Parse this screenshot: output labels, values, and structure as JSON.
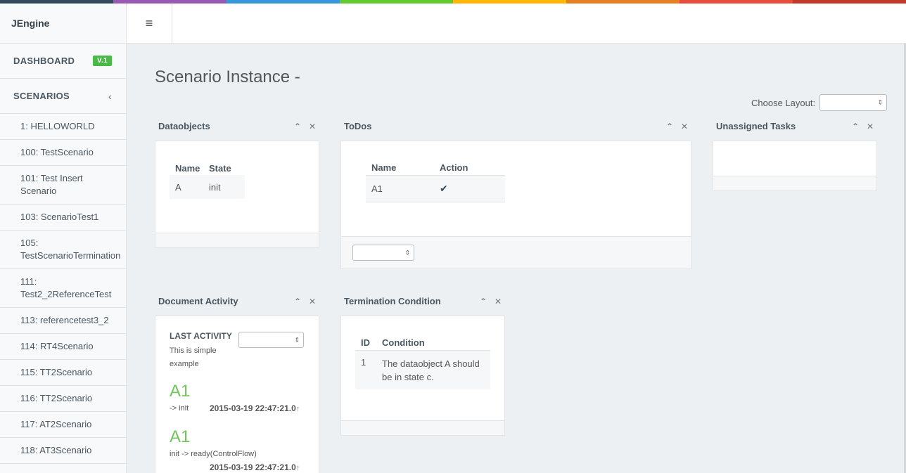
{
  "colors": {
    "topbar": [
      "#34495e",
      "#9b59b6",
      "#3498db",
      "#62cb31",
      "#ffb606",
      "#e67e22",
      "#e74c3c",
      "#c0392b"
    ],
    "accent_green": "#62cb31"
  },
  "sidebar": {
    "brand": "JEngine",
    "dashboard_label": "DASHBOARD",
    "dashboard_badge": "V.1",
    "scenarios_label": "SCENARIOS",
    "scenarios_chevron_icon": "chevron-left-icon",
    "items": [
      {
        "line1": "1: HELLOWORLD",
        "line2": ""
      },
      {
        "line1": "100: TestScenario",
        "line2": ""
      },
      {
        "line1": "101: Test Insert",
        "line2": "Scenario"
      },
      {
        "line1": "103: ScenarioTest1",
        "line2": ""
      },
      {
        "line1": "105:",
        "line2": "TestScenarioTermination"
      },
      {
        "line1": "111:",
        "line2": "Test2_2ReferenceTest"
      },
      {
        "line1": "113: referencetest3_2",
        "line2": ""
      },
      {
        "line1": "114: RT4Scenario",
        "line2": ""
      },
      {
        "line1": "115: TT2Scenario",
        "line2": ""
      },
      {
        "line1": "116: TT2Scenario",
        "line2": ""
      },
      {
        "line1": "117: AT2Scenario",
        "line2": ""
      },
      {
        "line1": "118: AT3Scenario",
        "line2": ""
      }
    ]
  },
  "header": {
    "menu_icon": "hamburger-icon"
  },
  "main": {
    "title": "Scenario Instance -",
    "choose_layout_label": "Choose Layout:",
    "choose_layout_value": ""
  },
  "panels": {
    "dataobjects": {
      "title": "Dataobjects",
      "columns": [
        "Name",
        "State"
      ],
      "rows": [
        [
          "A",
          "init"
        ]
      ]
    },
    "todos": {
      "title": "ToDos",
      "columns": [
        "Name",
        "Action"
      ],
      "rows": [
        {
          "name": "A1",
          "action_icon": "check-icon"
        }
      ],
      "select_value": ""
    },
    "unassigned": {
      "title": "Unassigned Tasks"
    },
    "activity": {
      "title": "Document Activity",
      "last_activity_label": "LAST ACTIVITY",
      "description": "This is simple example",
      "select_value": "",
      "entries": [
        {
          "name": "A1",
          "transition": "-> init",
          "timestamp": "2015-03-19 22:47:21.0"
        },
        {
          "name": "A1",
          "transition": "init -> ready(ControlFlow)",
          "timestamp": "2015-03-19 22:47:21.0"
        }
      ]
    },
    "termination": {
      "title": "Termination Condition",
      "columns": [
        "ID",
        "Condition"
      ],
      "rows": [
        [
          "1",
          "The dataobject A should be in state c."
        ]
      ]
    },
    "controls": {
      "collapse_icon": "chevron-up-icon",
      "close_icon": "close-icon"
    }
  }
}
